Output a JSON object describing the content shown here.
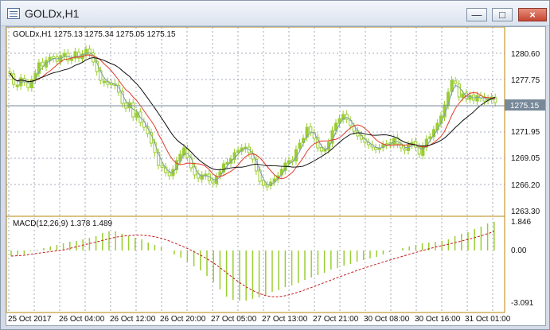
{
  "window": {
    "title": "GOLDx,H1",
    "controls": [
      "minimize",
      "maximize",
      "close"
    ]
  },
  "main_chart": {
    "header": "GOLDx,H1  1275.13 1275.34 1275.05 1275.15",
    "current_price": "1275.15",
    "y_labels": [
      "1280.60",
      "1277.75",
      "1275.15",
      "1271.95",
      "1269.05",
      "1266.20",
      "1263.30"
    ],
    "colors": {
      "up": "#9acd32",
      "down": "#9acd32",
      "ma_red": "#e33b2a",
      "ma_black": "#111111",
      "ma_blue": "#7f9fa5"
    }
  },
  "macd": {
    "label": "MACD(12,26,9) 1.378 1.489",
    "y_labels": [
      "1.846",
      "0.00",
      "-3.091"
    ]
  },
  "x_labels": [
    "25 Oct 2017",
    "26 Oct 04:00",
    "26 Oct 12:00",
    "26 Oct 20:00",
    "27 Oct 05:00",
    "27 Oct 13:00",
    "27 Oct 21:00",
    "30 Oct 08:00",
    "30 Oct 16:00",
    "31 Oct 01:00"
  ]
}
